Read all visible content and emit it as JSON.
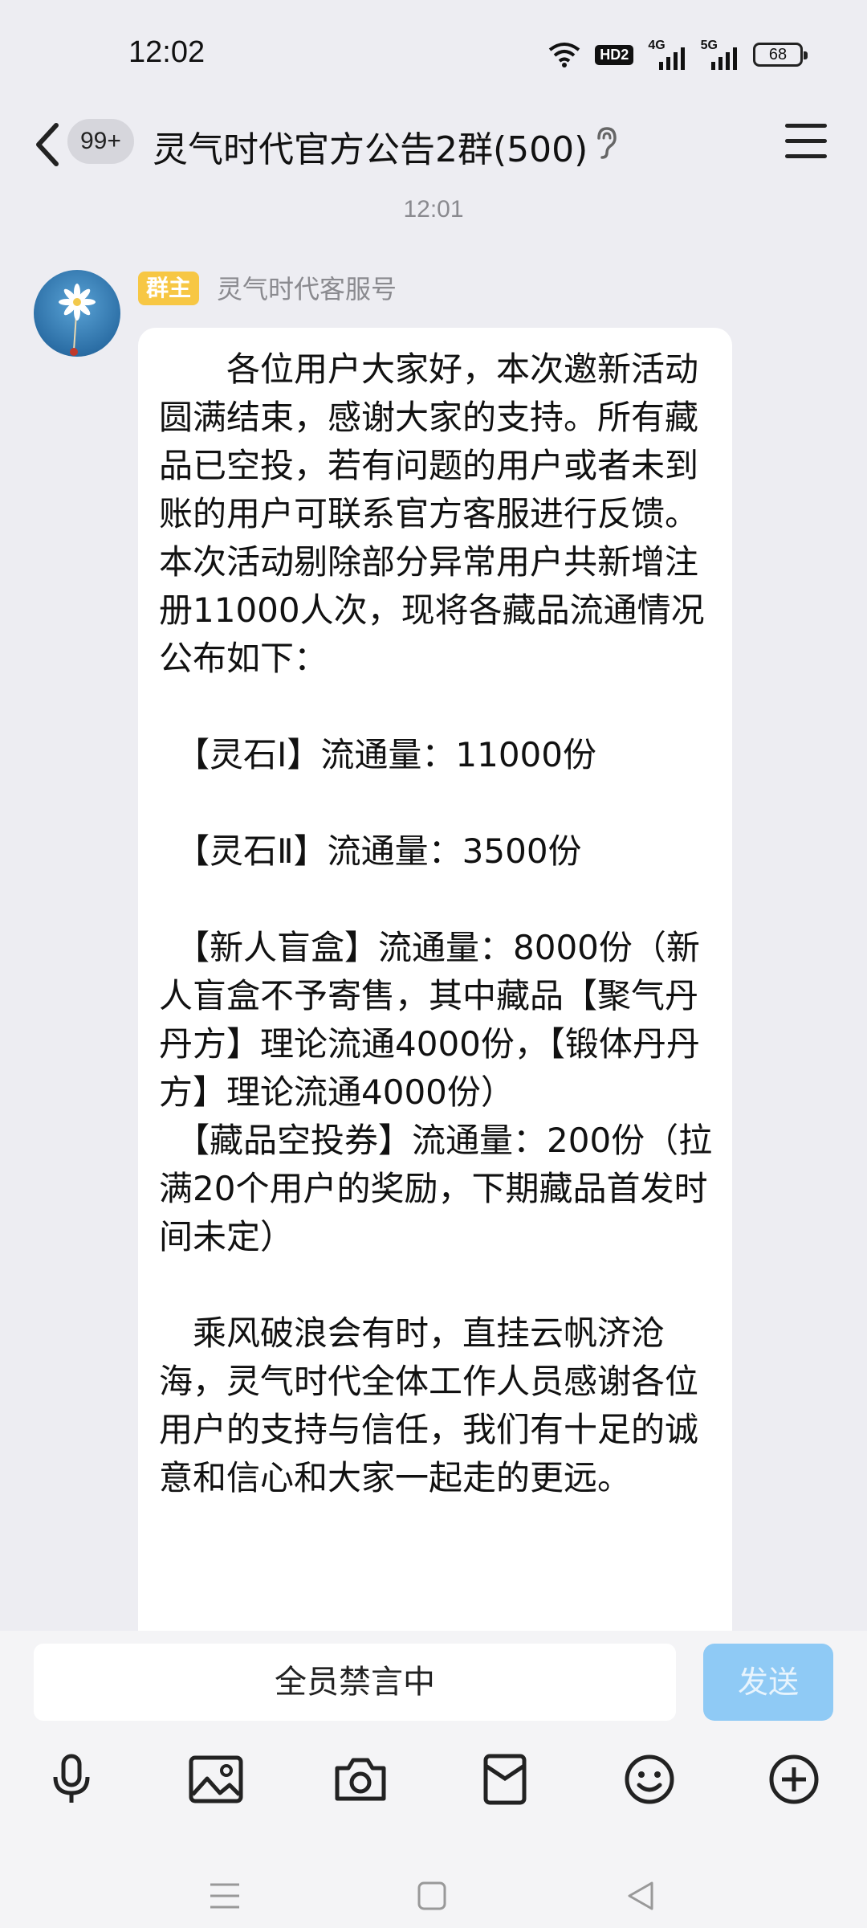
{
  "status_bar": {
    "time": "12:02",
    "hd_label": "HD2",
    "net1_label": "4G",
    "net2_label": "5G",
    "battery": "68",
    "icons": [
      "wifi-icon",
      "hd-icon",
      "signal-4g-icon",
      "signal-5g-icon",
      "battery-icon"
    ]
  },
  "header": {
    "back_icon": "chevron-left-icon",
    "unread_badge": "99+",
    "title": "灵气时代官方公告2群(500)",
    "ear_icon": "ear-icon",
    "menu_icon": "hamburger-menu-icon"
  },
  "timestamp": "12:01",
  "message": {
    "role_badge": "群主",
    "sender": "灵气时代客服号",
    "text": "　　各位用户大家好，本次邀新活动圆满结束，感谢大家的支持。所有藏品已空投，若有问题的用户或者未到账的用户可联系官方客服进行反馈。本次活动剔除部分异常用户共新增注册11000人次，现将各藏品流通情况公布如下：\n\n　【灵石Ⅰ】流通量：11000份\n\n　【灵石Ⅱ】流通量：3500份\n\n　【新人盲盒】流通量：8000份（新人盲盒不予寄售，其中藏品【聚气丹丹方】理论流通4000份，【锻体丹丹方】理论流通4000份）\n　【藏品空投券】流通量：200份（拉满20个用户的奖励，下期藏品首发时间未定）\n\n　乘风破浪会有时，直挂云帆济沧海，灵气时代全体工作人员感谢各位用户的支持与信任，我们有十足的诚意和信心和大家一起走的更远。"
  },
  "input": {
    "value": "全员禁言中",
    "send_label": "发送"
  },
  "toolbar": [
    "microphone-icon",
    "image-icon",
    "camera-icon",
    "red-packet-icon",
    "emoji-icon",
    "plus-icon"
  ],
  "navbar": [
    "menu-nav-icon",
    "home-nav-icon",
    "back-nav-icon"
  ],
  "colors": {
    "background": "#ededf2",
    "bubble": "#ffffff",
    "owner_badge": "#f7c744",
    "send_button": "#8fcaf5"
  }
}
